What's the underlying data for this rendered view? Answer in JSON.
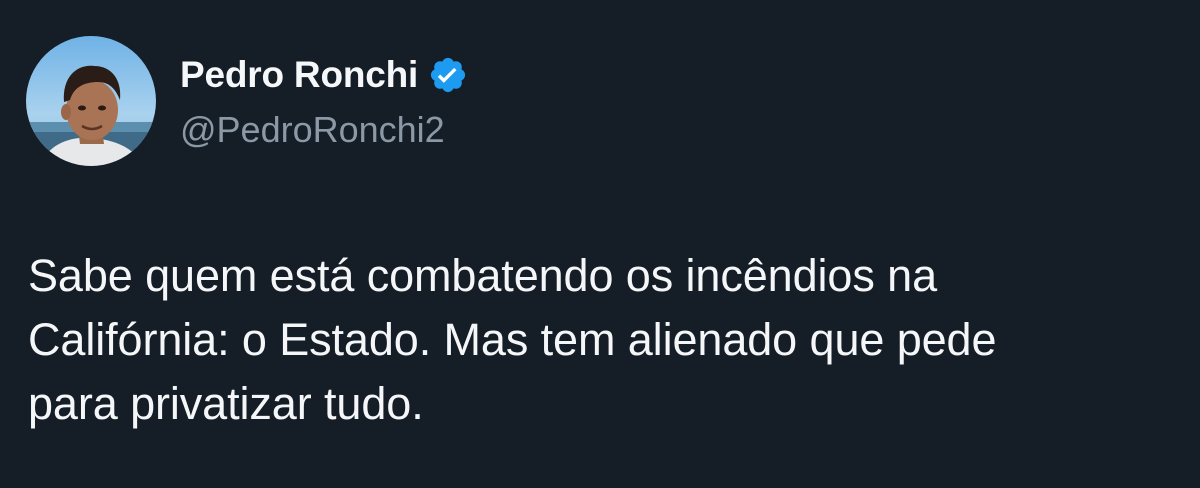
{
  "author": {
    "display_name": "Pedro Ronchi",
    "handle": "@PedroRonchi2",
    "verified": true,
    "verified_icon": "verified-badge-icon",
    "avatar_icon": "profile-photo"
  },
  "tweet": {
    "lines": [
      "Sabe quem está combatendo os incêndios na",
      "Califórnia: o Estado. Mas tem alienado que pede",
      "para privatizar tudo."
    ]
  },
  "colors": {
    "background": "#151d27",
    "text": "#f4f6f8",
    "handle": "#8b98a5",
    "verified": "#1d9bf0"
  }
}
